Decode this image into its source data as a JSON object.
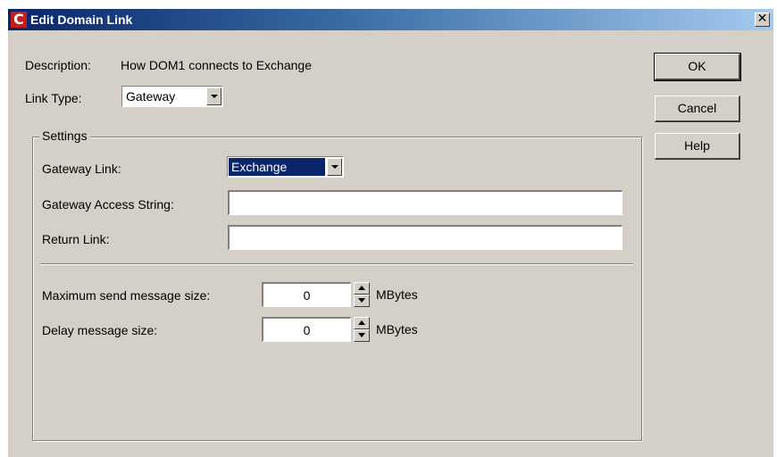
{
  "window": {
    "title": "Edit Domain Link",
    "app_icon_letter": "C",
    "close_glyph": "✕"
  },
  "description": {
    "label": "Description:",
    "value": "How DOM1 connects to Exchange"
  },
  "link_type": {
    "label": "Link Type:",
    "value": "Gateway"
  },
  "settings": {
    "title": "Settings",
    "gateway_link": {
      "label": "Gateway Link:",
      "value": "Exchange"
    },
    "gateway_access_string": {
      "label": "Gateway Access String:",
      "value": ""
    },
    "return_link": {
      "label": "Return Link:",
      "value": ""
    },
    "max_send_size": {
      "label": "Maximum send message size:",
      "value": "0",
      "unit": "MBytes"
    },
    "delay_size": {
      "label": "Delay message size:",
      "value": "0",
      "unit": "MBytes"
    }
  },
  "buttons": {
    "ok": "OK",
    "cancel": "Cancel",
    "help": "Help"
  },
  "colors": {
    "dialog_bg": "#d4d0c8",
    "title_gradient_start": "#0a246a",
    "title_gradient_end": "#a6caf0",
    "selection_bg": "#0a246a",
    "app_icon_red": "#c41e1e"
  },
  "icons": [
    "app-logo-icon",
    "close-icon",
    "dropdown-arrow-icon",
    "spin-up-icon",
    "spin-down-icon"
  ]
}
